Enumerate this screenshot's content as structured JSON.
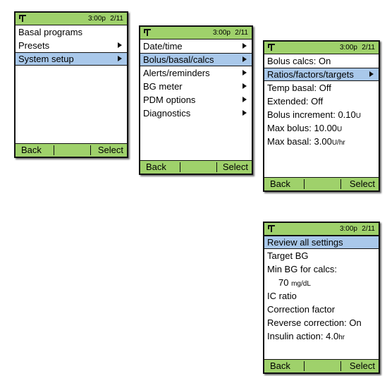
{
  "status_bar": {
    "time": "3:00p",
    "date": "2/11"
  },
  "softkeys": {
    "back": "Back",
    "select": "Select"
  },
  "screen_home": {
    "items": [
      "Basal programs",
      "Presets",
      "System setup"
    ]
  },
  "screen_system_setup": {
    "items": [
      "Date/time",
      "Bolus/basal/calcs",
      "Alerts/reminders",
      "BG meter",
      "PDM options",
      "Diagnostics"
    ]
  },
  "screen_bolus_basal": {
    "items": [
      {
        "label": "Bolus calcs:",
        "value": "On"
      },
      {
        "label": "Ratios/factors/targets"
      },
      {
        "label": "Temp basal:",
        "value": "Off"
      },
      {
        "label": "Extended:",
        "value": "Off"
      },
      {
        "label": "Bolus increment:",
        "value": "0.10",
        "unit": "U"
      },
      {
        "label": "Max bolus:",
        "value": "10.00",
        "unit": "U"
      },
      {
        "label": "Max basal:",
        "value": "3.00",
        "unit": "U/hr"
      }
    ]
  },
  "screen_ratios": {
    "items": [
      {
        "label": "Review all settings"
      },
      {
        "label": "Target BG"
      },
      {
        "label": "Min BG for calcs:"
      },
      {
        "value": "70",
        "unit": "mg/dL"
      },
      {
        "label": "IC ratio"
      },
      {
        "label": "Correction factor"
      },
      {
        "label": "Reverse correction:",
        "value": "On"
      },
      {
        "label": "Insulin action:",
        "value": "4.0",
        "unit": "hr"
      }
    ]
  }
}
